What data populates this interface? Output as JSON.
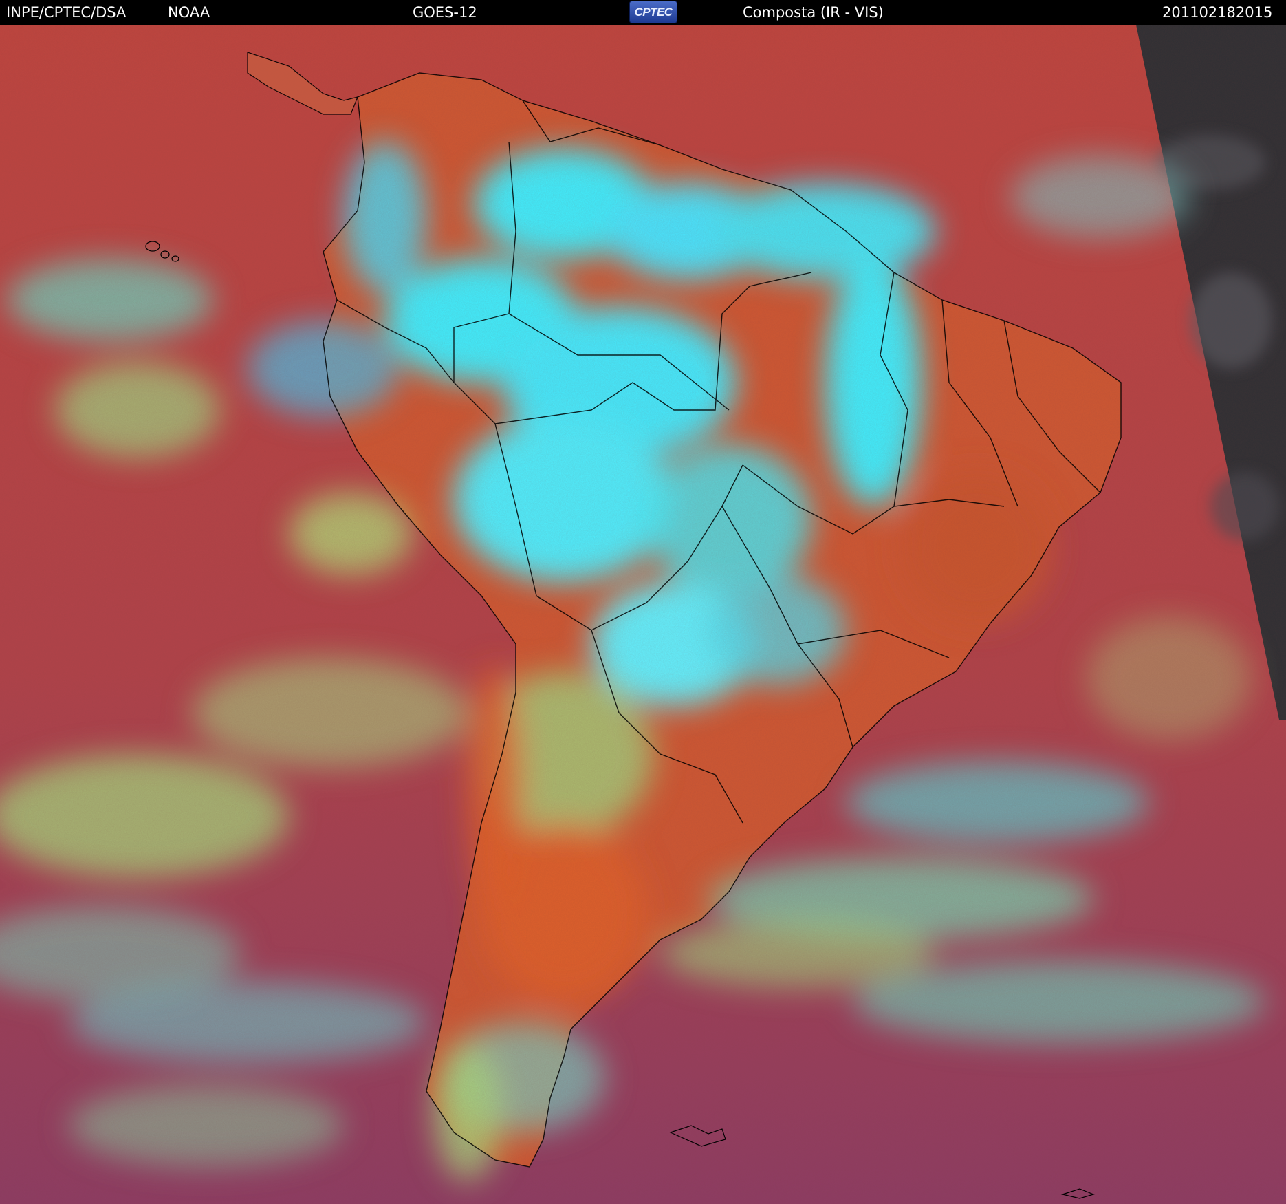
{
  "header": {
    "agency": "INPE/CPTEC/DSA",
    "provider": "NOAA",
    "satellite": "GOES-12",
    "logo_text": "CPTEC",
    "product": "Composta (IR - VIS)",
    "timestamp": "201102182015"
  },
  "colors": {
    "clear_ocean": "#b1434a",
    "clear_land": "#d35a2f",
    "high_cloud": "#3ff0ff",
    "mid_cloud": "#6fd8b0",
    "low_cloud": "#a8e07a",
    "space_night": "#2e3034",
    "borders": "#000000"
  }
}
